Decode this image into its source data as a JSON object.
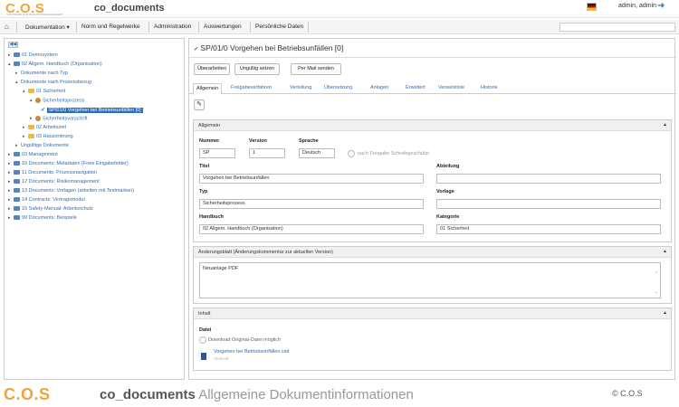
{
  "header": {
    "logo": "C.O.S",
    "logo_tagline": "SOFTWARE FÜR QUALITÄTSMANAGEMENT",
    "app_title": "co_documents",
    "user": "admin, admin",
    "flag_icon": "german-flag-icon",
    "logout_icon": "logout-icon"
  },
  "menu": {
    "home_icon": "home-icon",
    "items": [
      "Dokumentation ▾",
      "Norm und Regelwerke",
      "Administration",
      "Auswertungen",
      "Persönliche Daten"
    ],
    "search_placeholder": ""
  },
  "tree": {
    "collapse_label": "◀◀",
    "items": [
      {
        "label": "01 Demosystem",
        "icon": "db"
      },
      {
        "label": "02 Allgem. Handbuch (Organisation)",
        "icon": "db"
      },
      {
        "label": "Dokumente nach Typ",
        "icon": "none"
      },
      {
        "label": "Dokumente nach Prozessbezug",
        "icon": "none"
      },
      {
        "label": "01 Sicherheit",
        "icon": "folder"
      },
      {
        "label": "Sicherheitsprozess",
        "icon": "gear"
      },
      {
        "label": "SP/01/0 Vorgehen bei Betriebsunfällen [0]",
        "icon": "check"
      },
      {
        "label": "Sicherheitsvorschrift",
        "icon": "gear"
      },
      {
        "label": "02 Arbeitszeit",
        "icon": "folder"
      },
      {
        "label": "03 Hausordnung",
        "icon": "folder"
      },
      {
        "label": "Ungültige Dokumente",
        "icon": "none"
      },
      {
        "label": "03 Management",
        "icon": "db"
      },
      {
        "label": "10 Documents: Metadaten (Freie Eingabefelder)",
        "icon": "db"
      },
      {
        "label": "11 Documents: Prozessnavigation",
        "icon": "db"
      },
      {
        "label": "12 Documents: Risikomanagement",
        "icon": "db"
      },
      {
        "label": "13 Documents: Vorlagen (arbeiten mit Textmarken)",
        "icon": "db"
      },
      {
        "label": "14 Contracts: Vertragsmodul",
        "icon": "db"
      },
      {
        "label": "15 Safety-Manual: Arbeitsschutz",
        "icon": "db"
      },
      {
        "label": "99 Documents: Beispiele",
        "icon": "db"
      }
    ]
  },
  "document": {
    "title": "SP/01/0 Vorgehen bei Betriebsunfällen [0]",
    "buttons": [
      "Überarbeiten",
      "Ungültig setzen",
      "Per Mail senden"
    ],
    "tabs": [
      "Allgemein",
      "Freigabeverfahren",
      "Verteilung",
      "Übersetzung",
      "Anlagen",
      "Erweitert",
      "Verweisliste",
      "Historie"
    ],
    "edit_icon": "pencil-icon"
  },
  "allgemein": {
    "section_title": "Allgemein",
    "nummer_label": "Nummer",
    "nummer_value": "SP",
    "version_label": "Version",
    "version_value": "1",
    "sprache_label": "Sprache",
    "sprache_value": "Deutsch",
    "schreibschutz_label": "nach Freigabe Schreibgeschützt",
    "titel_label": "Titel",
    "titel_value": "Vorgehen bei Betriebsunfällen",
    "abteilung_label": "Abteilung",
    "abteilung_value": "",
    "typ_label": "Typ",
    "typ_value": "Sicherheitsprozess",
    "vorlage_label": "Vorlage",
    "vorlage_value": "",
    "handbuch_label": "Handbuch",
    "handbuch_value": "02 Allgem. Handbuch (Organisation)",
    "kategorie_label": "Kategorie",
    "kategorie_value": "01 Sicherheit"
  },
  "aenderung": {
    "section_title": "Änderungsblatt (Änderungskommentar zur aktuellen Version)",
    "text": "Neuanlage PDF"
  },
  "inhalt": {
    "section_title": "Inhalt",
    "datei_label": "Datei",
    "download_label": "Download Original-Datei möglich",
    "file_name": "Vorgehen bei Betriebsunfällen.vsd",
    "file_size": "73.00 KB",
    "file_icon": "word-file-icon"
  },
  "footer": {
    "logo": "C.O.S",
    "title": "co_documents",
    "subtitle": " Allgemeine Dokumentinformationen",
    "copyright": "© C.O.S"
  }
}
